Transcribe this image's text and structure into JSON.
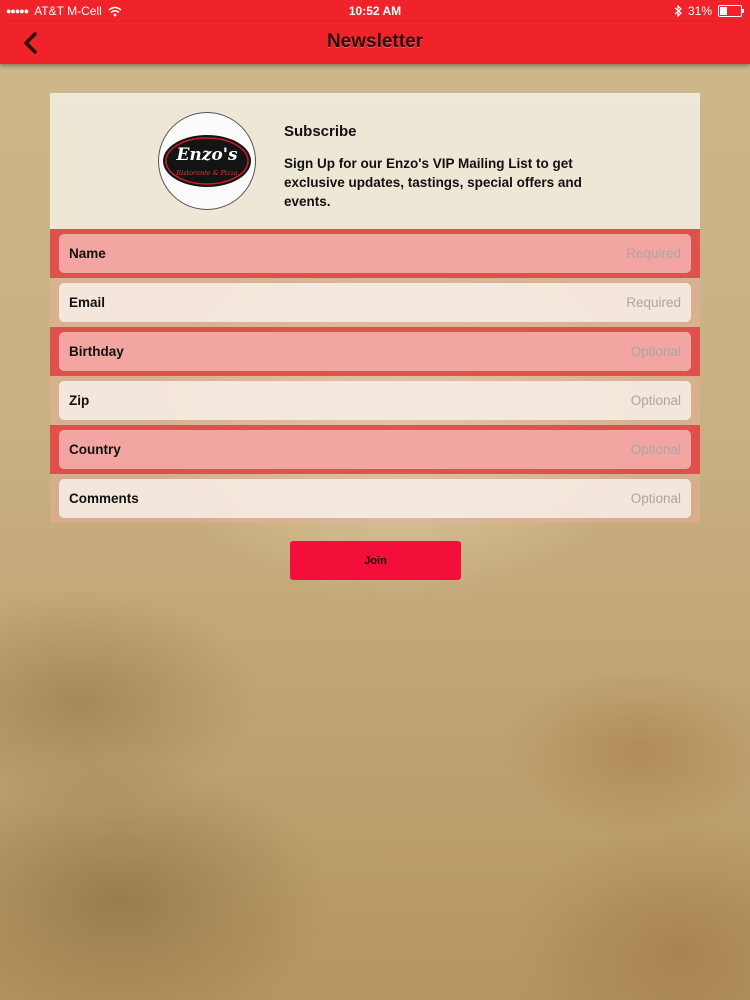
{
  "status_bar": {
    "signal": "●●●●●",
    "carrier": "AT&T M-Cell",
    "time": "10:52 AM",
    "battery_text": "31%",
    "battery_level": 0.31,
    "wifi_icon": "wifi-icon",
    "bluetooth_icon": "bluetooth-icon"
  },
  "nav": {
    "title": "Newsletter",
    "back_icon": "chevron-left-icon",
    "bar_color": "#f0232a"
  },
  "header": {
    "logo_icon": "enzos-logo",
    "logo_text": "Enzo's",
    "logo_subtext": "Ristorante & Pizza",
    "title": "Subscribe",
    "description": "Sign Up for our Enzo's VIP Mailing List to get exclusive updates, tastings, special offers and events."
  },
  "form": {
    "fields": [
      {
        "label": "Name",
        "placeholder": "Required"
      },
      {
        "label": "Email",
        "placeholder": "Required"
      },
      {
        "label": "Birthday",
        "placeholder": "Optional"
      },
      {
        "label": "Zip",
        "placeholder": "Optional"
      },
      {
        "label": "Country",
        "placeholder": "Optional"
      },
      {
        "label": "Comments",
        "placeholder": "Optional"
      }
    ]
  },
  "join_button": {
    "label": "Join",
    "color": "#f40f3a"
  }
}
